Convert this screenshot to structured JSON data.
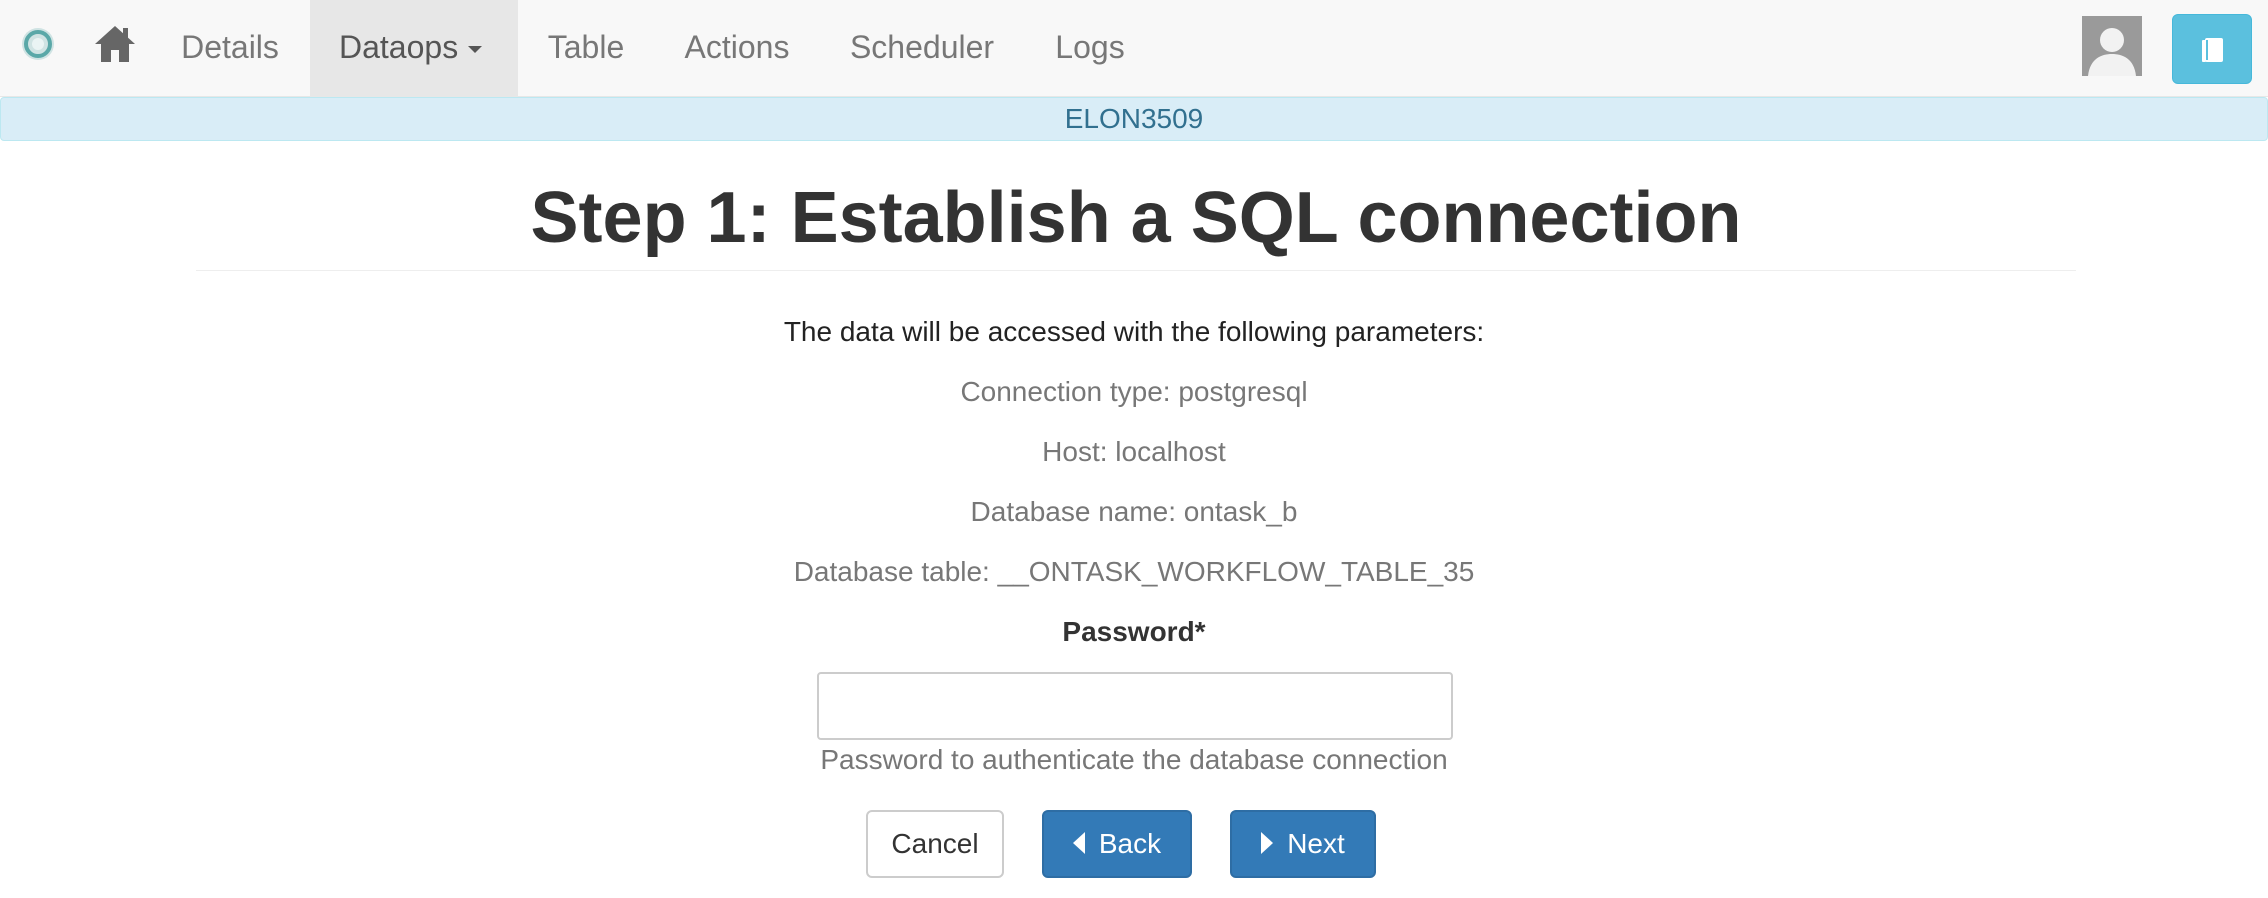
{
  "nav": {
    "brand_icon": "ontask-logo-icon",
    "home_icon": "home-icon",
    "items": [
      {
        "label": "Details"
      },
      {
        "label": "Dataops"
      },
      {
        "label": "Table"
      },
      {
        "label": "Actions"
      },
      {
        "label": "Scheduler"
      },
      {
        "label": "Logs"
      }
    ],
    "active_item": "Dataops",
    "avatar_icon": "user-avatar-icon",
    "help_icon": "book-icon"
  },
  "banner": {
    "workflow_name": "ELON3509"
  },
  "page": {
    "title": "Step 1: Establish a SQL connection"
  },
  "params": {
    "intro": "The data will be accessed with the following parameters:",
    "connection_type": "Connection type: postgresql",
    "host": "Host: localhost",
    "database_name": "Database name: ontask_b",
    "database_table": "Database table: __ONTASK_WORKFLOW_TABLE_35"
  },
  "form": {
    "password_label": "Password*",
    "password_value": "",
    "password_help": "Password to authenticate the database connection"
  },
  "buttons": {
    "cancel": "Cancel",
    "back": "Back",
    "next": "Next"
  },
  "colors": {
    "primary": "#337ab7",
    "info": "#5bc0de",
    "banner_bg": "#d9edf7",
    "banner_text": "#31708f"
  }
}
